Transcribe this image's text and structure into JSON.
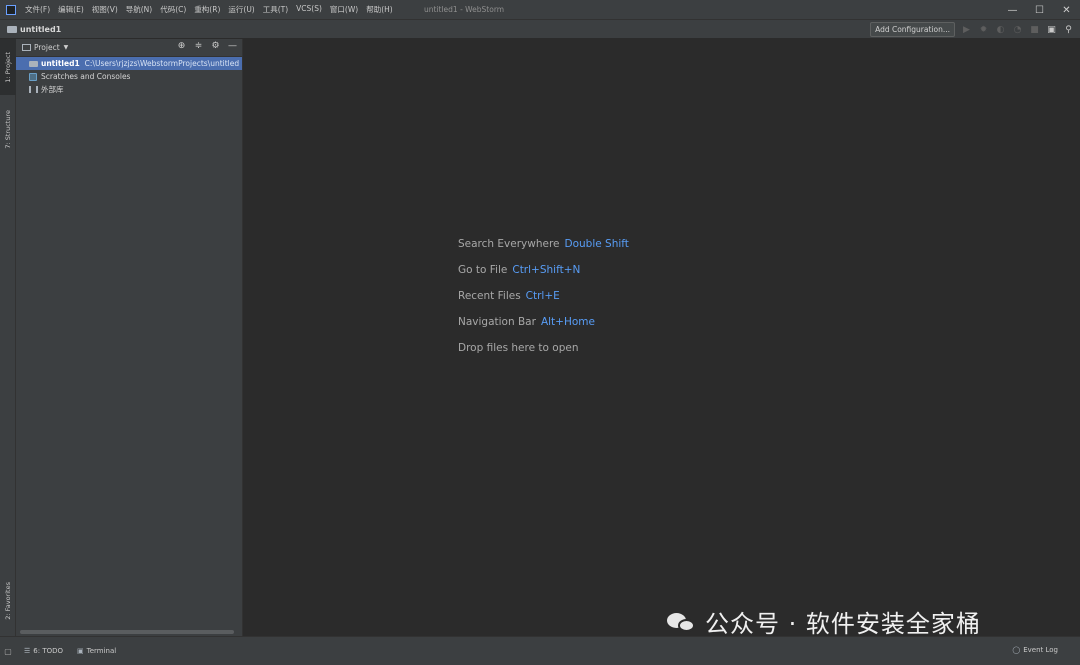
{
  "window": {
    "title": "untitled1 - WebStorm",
    "menu": [
      "文件(F)",
      "编辑(E)",
      "视图(V)",
      "导航(N)",
      "代码(C)",
      "重构(R)",
      "运行(U)",
      "工具(T)",
      "VCS(S)",
      "窗口(W)",
      "帮助(H)"
    ],
    "controls": {
      "minimize": "—",
      "maximize": "☐",
      "close": "✕"
    }
  },
  "navbar": {
    "breadcrumb": "untitled1",
    "add_configuration": "Add Configuration..."
  },
  "left_tool_tabs": {
    "project": "1: Project",
    "structure": "7: Structure",
    "favorites": "2: Favorites"
  },
  "project_panel": {
    "title": "Project",
    "tree": [
      {
        "name": "untitled1",
        "path": "C:\\Users\\rjzjzs\\WebstormProjects\\untitled",
        "selected": true
      },
      {
        "name": "Scratches and Consoles"
      },
      {
        "name": "外部库"
      }
    ]
  },
  "editor": {
    "hints": [
      {
        "label": "Search Everywhere",
        "shortcut": "Double Shift"
      },
      {
        "label": "Go to File",
        "shortcut": "Ctrl+Shift+N"
      },
      {
        "label": "Recent Files",
        "shortcut": "Ctrl+E"
      },
      {
        "label": "Navigation Bar",
        "shortcut": "Alt+Home"
      },
      {
        "label": "Drop files here to open",
        "shortcut": ""
      }
    ]
  },
  "status_bar": {
    "todo": "6: TODO",
    "terminal": "Terminal",
    "event_log": "Event Log"
  },
  "watermark": {
    "text": "公众号 · 软件安装全家桶"
  },
  "colors": {
    "accent": "#589df6",
    "selection": "#4b6eaf",
    "editor_bg": "#2b2b2b",
    "panel_bg": "#3c3f41"
  }
}
